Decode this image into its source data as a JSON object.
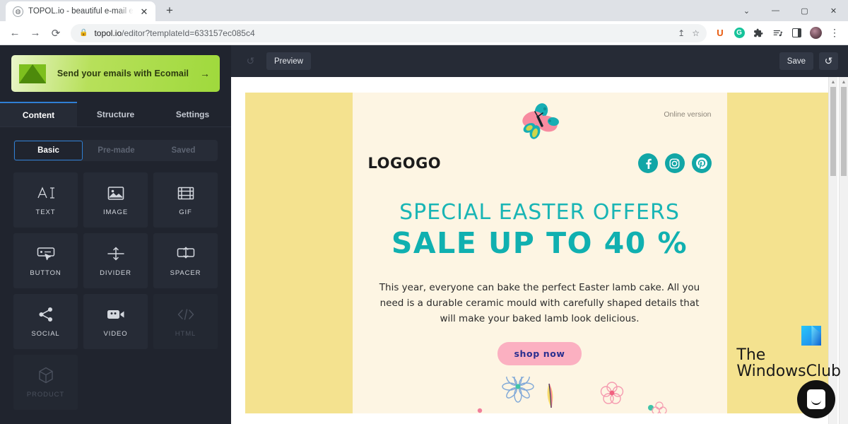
{
  "browser": {
    "tab": {
      "favicon": "page-icon",
      "title": "TOPOL.io - beautiful e-mail editor",
      "close": "✕"
    },
    "new_tab": "+",
    "window_controls": {
      "minimize": "—",
      "maximize": "▢",
      "close": "✕",
      "collapse": "⌄"
    },
    "nav": {
      "back": "←",
      "forward": "→",
      "reload": "⟳"
    },
    "omnibox": {
      "lock_icon": "lock-icon",
      "url_domain": "topol.io",
      "url_path": "/editor?templateId=633157ec085c4",
      "share_icon": "↥",
      "bookmark_icon": "☆"
    },
    "extensions": [
      {
        "name": "ext-u-icon",
        "label": "U"
      },
      {
        "name": "grammarly-icon",
        "label": "G"
      },
      {
        "name": "puzzle-icon",
        "label": "🧩"
      },
      {
        "name": "reading-list-icon",
        "label": "≡♪"
      },
      {
        "name": "side-panel-icon",
        "label": ""
      },
      {
        "name": "profile-avatar",
        "label": ""
      }
    ],
    "menu_icon": "⋮"
  },
  "sidebar": {
    "promo": {
      "logo": "ecomail-envelope-icon",
      "text": "Send your emails with Ecomail",
      "arrow": "→"
    },
    "tabs": [
      {
        "label": "Content",
        "active": true
      },
      {
        "label": "Structure",
        "active": false
      },
      {
        "label": "Settings",
        "active": false
      }
    ],
    "subtabs": [
      {
        "label": "Basic",
        "active": true,
        "disabled": false
      },
      {
        "label": "Pre-made",
        "active": false,
        "disabled": true
      },
      {
        "label": "Saved",
        "active": false,
        "disabled": true
      }
    ],
    "blocks": [
      {
        "label": "TEXT",
        "icon": "text-icon",
        "disabled": false
      },
      {
        "label": "IMAGE",
        "icon": "image-icon",
        "disabled": false
      },
      {
        "label": "GIF",
        "icon": "gif-icon",
        "disabled": false
      },
      {
        "label": "BUTTON",
        "icon": "button-icon",
        "disabled": false
      },
      {
        "label": "DIVIDER",
        "icon": "divider-icon",
        "disabled": false
      },
      {
        "label": "SPACER",
        "icon": "spacer-icon",
        "disabled": false
      },
      {
        "label": "SOCIAL",
        "icon": "social-share-icon",
        "disabled": false
      },
      {
        "label": "VIDEO",
        "icon": "video-camera-icon",
        "disabled": false
      },
      {
        "label": "HTML",
        "icon": "code-icon",
        "disabled": true
      },
      {
        "label": "PRODUCT",
        "icon": "cube-icon",
        "disabled": true
      }
    ]
  },
  "editor_bar": {
    "undo_icon": "↺",
    "preview_label": "Preview",
    "save_label": "Save",
    "history_icon": "↺"
  },
  "email": {
    "online_version": "Online version",
    "logo": "LOGOGO",
    "socials": [
      {
        "name": "facebook-icon",
        "glyph": "f"
      },
      {
        "name": "instagram-icon",
        "glyph": ""
      },
      {
        "name": "pinterest-icon",
        "glyph": "p"
      }
    ],
    "headline_1": "SPECIAL EASTER OFFERS",
    "headline_2": "SALE UP TO 40 %",
    "body": "This year, everyone can bake the perfect Easter lamb cake. All you need is a durable ceramic mould with carefully shaped details that will make your baked lamb look delicious.",
    "cta": "shop now"
  },
  "watermark": {
    "line1": "The",
    "line2": "WindowsClub"
  },
  "colors": {
    "accent_blue": "#2f7fd4",
    "sidebar_bg": "#20242e",
    "panel_bg": "#262b36",
    "email_yellow": "#f4e28f",
    "email_cream": "#fdf5e3",
    "teal": "#12a6a6",
    "pink": "#fbb0c1",
    "cta_text": "#2a2f8f",
    "promo_green": "#9fd93c"
  },
  "chat_widget": {
    "name": "intercom-messenger-launcher"
  }
}
